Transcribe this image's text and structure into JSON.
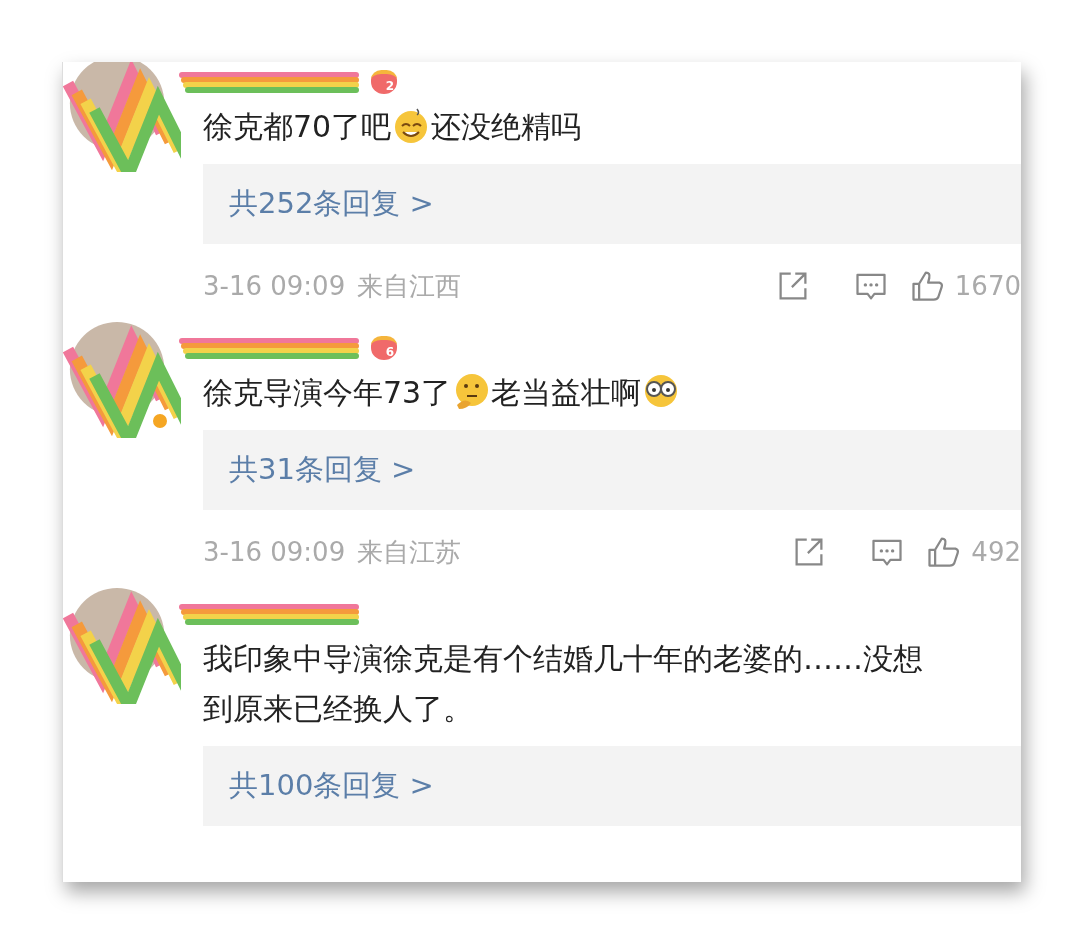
{
  "comments": [
    {
      "badge": "2",
      "verified": false,
      "segments": [
        {
          "kind": "text",
          "text": "徐克都70了吧"
        },
        {
          "kind": "sweat-emoji"
        },
        {
          "kind": "text",
          "text": "还没绝精吗"
        }
      ],
      "replies": "共252条回复 >",
      "time": "3-16 09:09",
      "location": "来自江西",
      "likes": "1670"
    },
    {
      "badge": "6",
      "verified": true,
      "segments": [
        {
          "kind": "text",
          "text": "徐克导演今年73了"
        },
        {
          "kind": "thinking-emoji"
        },
        {
          "kind": "text",
          "text": "老当益壮啊"
        },
        {
          "kind": "glasses-emoji"
        }
      ],
      "replies": "共31条回复 >",
      "time": "3-16 09:09",
      "location": "来自江苏",
      "likes": "492"
    },
    {
      "verified": false,
      "segments": [
        {
          "kind": "text",
          "text": "我印象中导演徐克是有个结婚几十年的老婆的……没想到原来已经换人了。"
        }
      ],
      "replies": "共100条回复 >"
    }
  ]
}
